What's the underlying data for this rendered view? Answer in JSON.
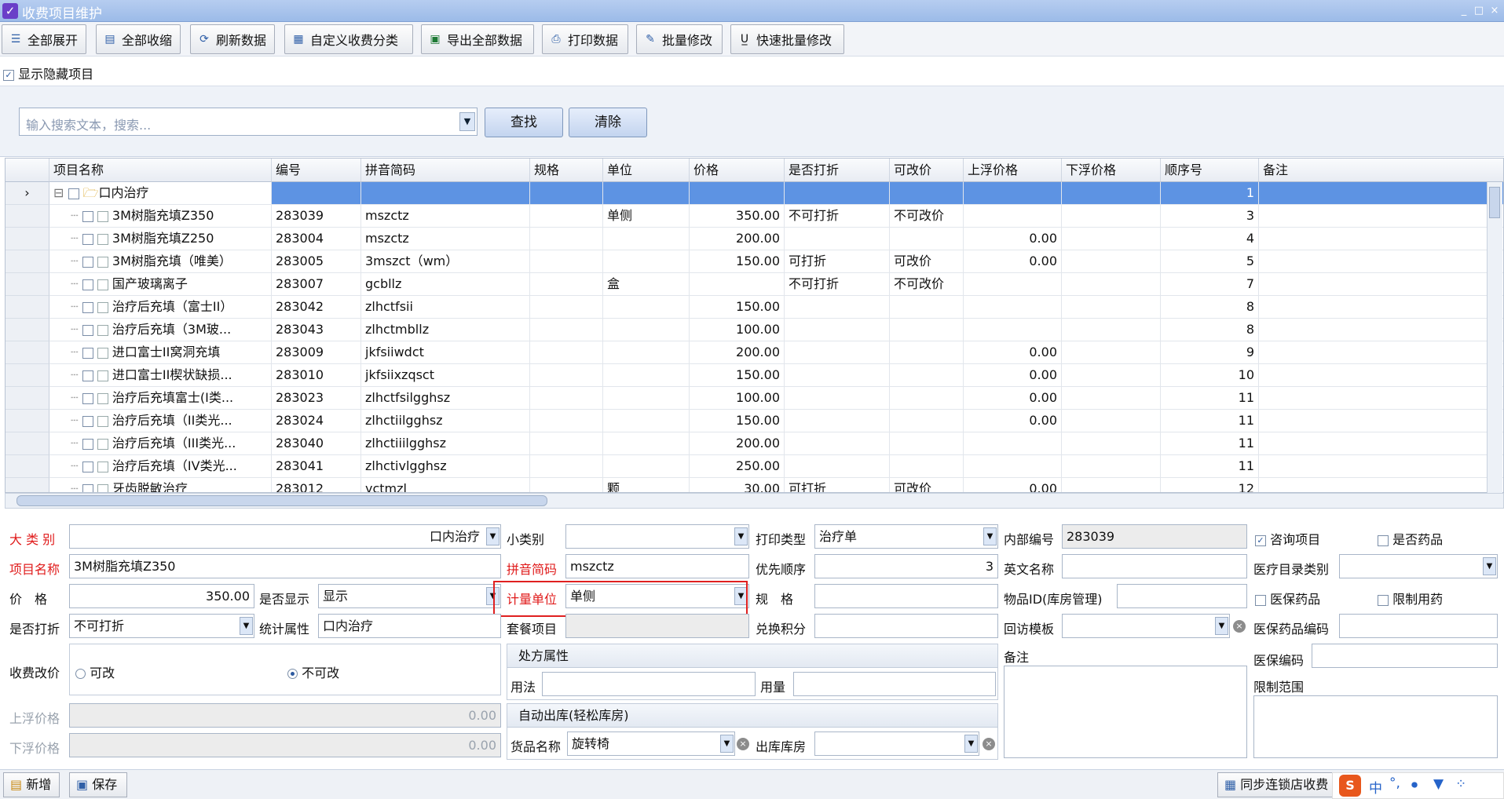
{
  "window": {
    "title": "收费项目维护",
    "min": "_",
    "max": "□",
    "close": "×"
  },
  "toolbar": {
    "expand_all": "全部展开",
    "collapse_all": "全部收缩",
    "refresh": "刷新数据",
    "custom_category": "自定义收费分类",
    "export_all": "导出全部数据",
    "print": "打印数据",
    "batch_edit": "批量修改",
    "quick_batch_edit": "快速批量修改"
  },
  "options": {
    "show_hidden": "显示隐藏项目"
  },
  "search": {
    "placeholder": "输入搜索文本，搜索...",
    "find_label": "查找",
    "clear_label": "清除"
  },
  "grid": {
    "columns": [
      "项目名称",
      "编号",
      "拼音简码",
      "规格",
      "单位",
      "价格",
      "是否打折",
      "可改价",
      "上浮价格",
      "下浮价格",
      "顺序号",
      "备注"
    ],
    "group": {
      "name": "口内治疗",
      "order": "1"
    },
    "rows": [
      {
        "name": "3M树脂充填Z350",
        "code": "283039",
        "pinyin": "mszctz",
        "spec": "",
        "unit": "单侧",
        "price": "350.00",
        "discount": "不可打折",
        "editable": "不可改价",
        "up": "",
        "down": "",
        "order": "3"
      },
      {
        "name": "3M树脂充填Z250",
        "code": "283004",
        "pinyin": "mszctz",
        "spec": "",
        "unit": "",
        "price": "200.00",
        "discount": "",
        "editable": "",
        "up": "0.00",
        "down": "",
        "order": "4"
      },
      {
        "name": "3M树脂充填（唯美）",
        "code": "283005",
        "pinyin": "3mszct（wm）",
        "spec": "",
        "unit": "",
        "price": "150.00",
        "discount": "可打折",
        "editable": "可改价",
        "up": "0.00",
        "down": "",
        "order": "5"
      },
      {
        "name": "国产玻璃离子",
        "code": "283007",
        "pinyin": "gcbllz",
        "spec": "",
        "unit": "盒",
        "price": "",
        "discount": "不可打折",
        "editable": "不可改价",
        "up": "",
        "down": "",
        "order": "7"
      },
      {
        "name": "治疗后充填（富士II）",
        "code": "283042",
        "pinyin": "zlhctfsii",
        "spec": "",
        "unit": "",
        "price": "150.00",
        "discount": "",
        "editable": "",
        "up": "",
        "down": "",
        "order": "8"
      },
      {
        "name": "治疗后充填（3M玻...",
        "code": "283043",
        "pinyin": "zlhctmbllz",
        "spec": "",
        "unit": "",
        "price": "100.00",
        "discount": "",
        "editable": "",
        "up": "",
        "down": "",
        "order": "8"
      },
      {
        "name": "进口富士II窝洞充填",
        "code": "283009",
        "pinyin": "jkfsiiwdct",
        "spec": "",
        "unit": "",
        "price": "200.00",
        "discount": "",
        "editable": "",
        "up": "0.00",
        "down": "",
        "order": "9"
      },
      {
        "name": "进口富士II楔状缺损...",
        "code": "283010",
        "pinyin": "jkfsiixzqsct",
        "spec": "",
        "unit": "",
        "price": "150.00",
        "discount": "",
        "editable": "",
        "up": "0.00",
        "down": "",
        "order": "10"
      },
      {
        "name": "治疗后充填富士(I类...",
        "code": "283023",
        "pinyin": "zlhctfsilgghsz",
        "spec": "",
        "unit": "",
        "price": "100.00",
        "discount": "",
        "editable": "",
        "up": "0.00",
        "down": "",
        "order": "11"
      },
      {
        "name": "治疗后充填（II类光...",
        "code": "283024",
        "pinyin": "zlhctiilgghsz",
        "spec": "",
        "unit": "",
        "price": "150.00",
        "discount": "",
        "editable": "",
        "up": "0.00",
        "down": "",
        "order": "11"
      },
      {
        "name": "治疗后充填（III类光...",
        "code": "283040",
        "pinyin": "zlhctiiilgghsz",
        "spec": "",
        "unit": "",
        "price": "200.00",
        "discount": "",
        "editable": "",
        "up": "",
        "down": "",
        "order": "11"
      },
      {
        "name": "治疗后充填（IV类光...",
        "code": "283041",
        "pinyin": "zlhctivlgghsz",
        "spec": "",
        "unit": "",
        "price": "250.00",
        "discount": "",
        "editable": "",
        "up": "",
        "down": "",
        "order": "11"
      },
      {
        "name": "牙齿脱敏治疗",
        "code": "283012",
        "pinyin": "yctmzl",
        "spec": "",
        "unit": "颗",
        "price": "30.00",
        "discount": "可打折",
        "editable": "可改价",
        "up": "0.00",
        "down": "",
        "order": "12"
      }
    ]
  },
  "form": {
    "category_label": "大 类 别",
    "category_value": "口内治疗",
    "subcategory_label": "小类别",
    "subcategory_value": "",
    "print_type_label": "打印类型",
    "print_type_value": "治疗单",
    "internal_code_label": "内部编号",
    "internal_code_value": "283039",
    "consult_label": "咨询项目",
    "is_drug_label": "是否药品",
    "name_label": "项目名称",
    "name_value": "3M树脂充填Z350",
    "pinyin_label": "拼音简码",
    "pinyin_value": "mszctz",
    "priority_label": "优先顺序",
    "priority_value": "3",
    "english_label": "英文名称",
    "english_value": "",
    "med_catalog_label": "医疗目录类别",
    "med_catalog_value": "",
    "price_label": "价　格",
    "price_value": "350.00",
    "show_label": "是否显示",
    "show_value": "显示",
    "unit_label": "计量单位",
    "unit_value": "单侧",
    "spec_label": "规　格",
    "spec_value": "",
    "item_id_label": "物品ID(库房管理)",
    "item_id_value": "",
    "insured_drug_label": "医保药品",
    "restricted_drug_label": "限制用药",
    "discount_label": "是否打折",
    "discount_value": "不可打折",
    "stat_label": "统计属性",
    "stat_value": "口内治疗",
    "package_label": "套餐项目",
    "package_value": "",
    "points_label": "兑换积分",
    "points_value": "",
    "revisit_label": "回访模板",
    "revisit_value": "",
    "insured_drug_code_label": "医保药品编码",
    "insured_drug_code_value": "",
    "price_edit_label": "收费改价",
    "price_edit_yes": "可改",
    "price_edit_no": "不可改",
    "rx_label": "处方属性",
    "usage_label": "用法",
    "usage_value": "",
    "dose_label": "用量",
    "dose_value": "",
    "remark_label": "备注",
    "insured_code_label": "医保编码",
    "insured_code_value": "",
    "limit_range_label": "限制范围",
    "up_price_label": "上浮价格",
    "up_price_value": "0.00",
    "down_price_label": "下浮价格",
    "down_price_value": "0.00",
    "auto_out_label": "自动出库(轻松库房)",
    "goods_label": "货品名称",
    "goods_value": "旋转椅",
    "warehouse_label": "出库库房",
    "warehouse_value": ""
  },
  "bottom": {
    "new_label": "新增",
    "save_label": "保存",
    "sync_label": "同步连锁店收费"
  },
  "ime": {
    "logo": "S",
    "lang": "中"
  }
}
